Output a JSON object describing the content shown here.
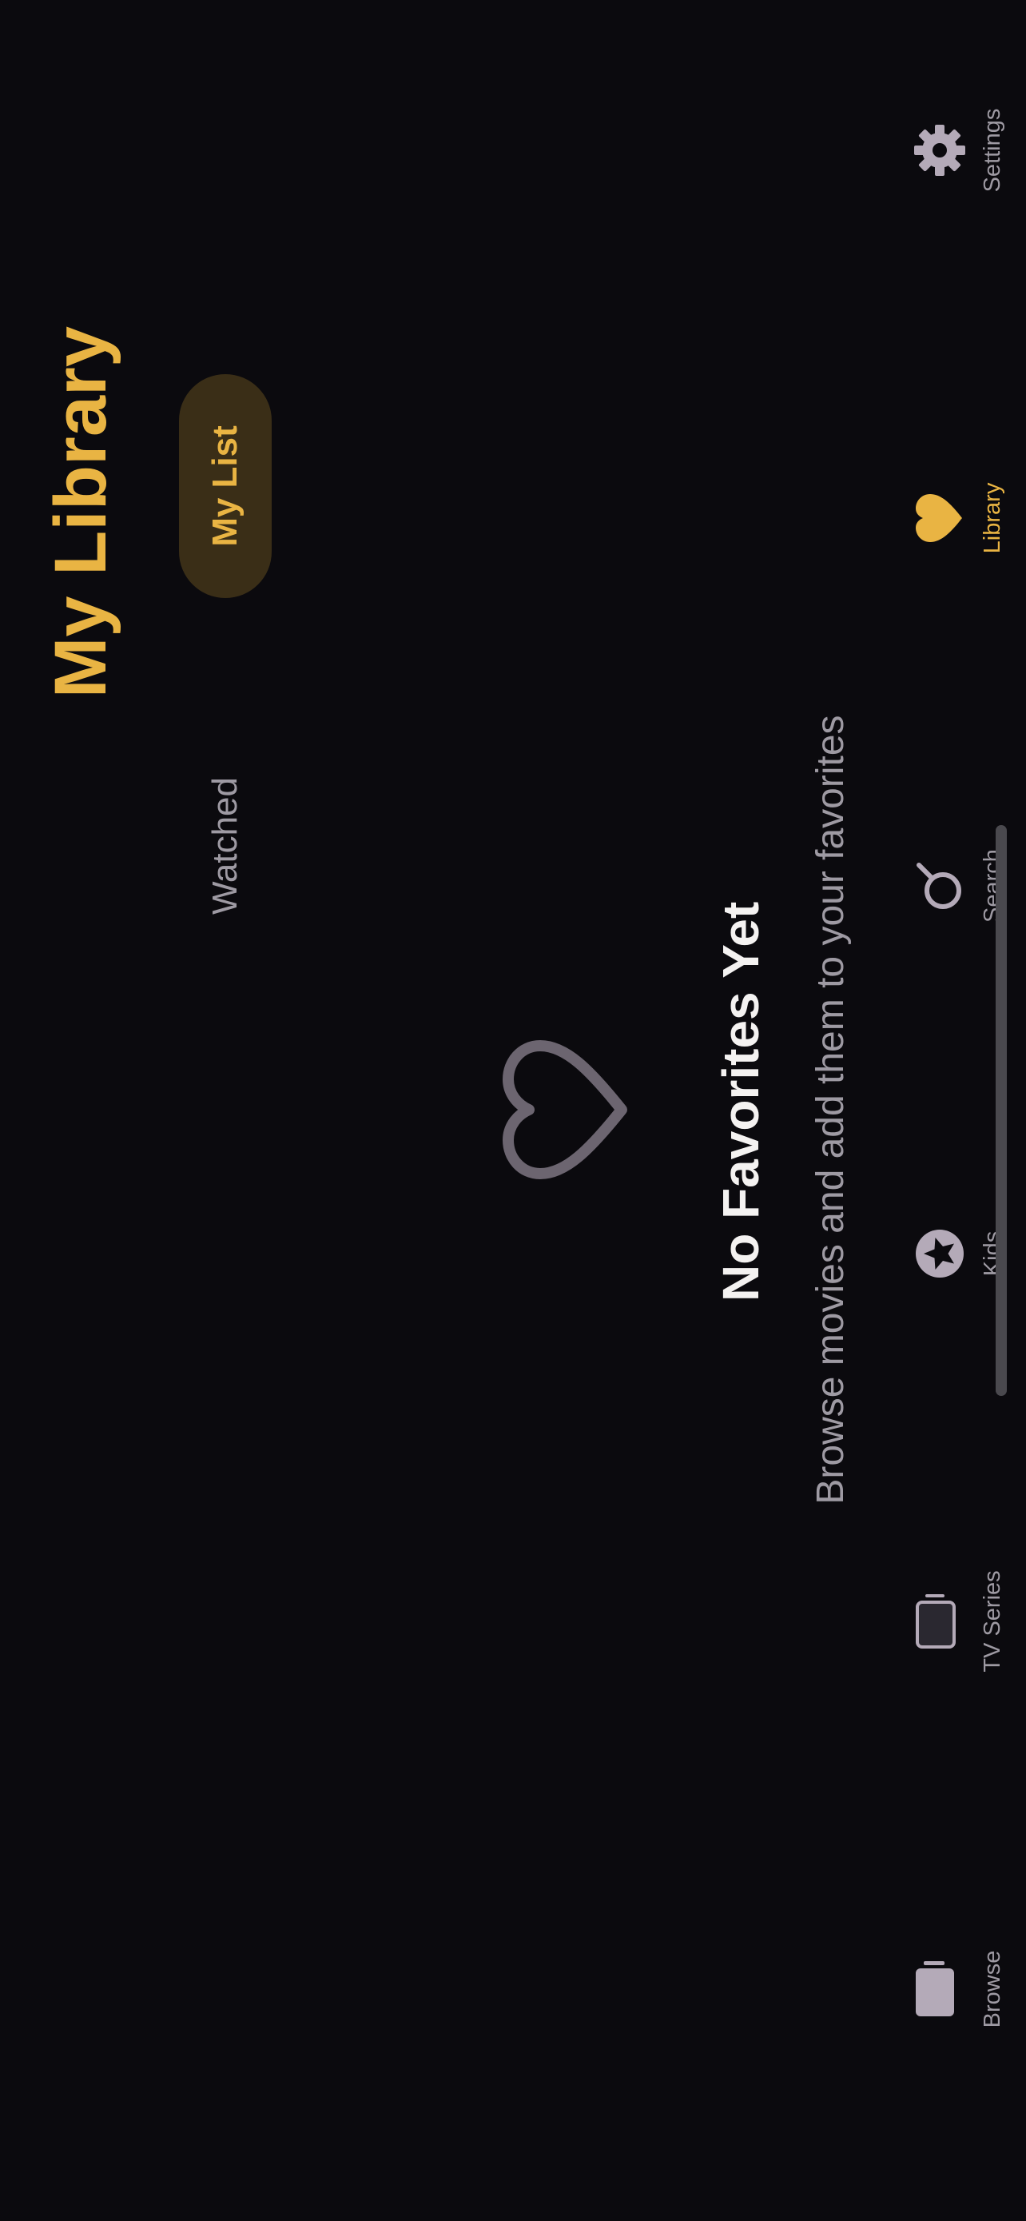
{
  "header": {
    "title": "My Library"
  },
  "segmented_control": {
    "tabs": [
      {
        "label": "My List",
        "selected": true
      },
      {
        "label": "Watched",
        "selected": false
      }
    ]
  },
  "empty_state": {
    "icon": "heart-outline-icon",
    "title": "No Favorites Yet",
    "subtitle": "Browse movies and add them to your favorites"
  },
  "tab_bar": {
    "items": [
      {
        "label": "Browse",
        "icon": "tv-filled-icon",
        "active": false
      },
      {
        "label": "TV Series",
        "icon": "tv-outline-icon",
        "active": false
      },
      {
        "label": "Kids",
        "icon": "star-circle-icon",
        "active": false
      },
      {
        "label": "Search",
        "icon": "magnifier-icon",
        "active": false
      },
      {
        "label": "Library",
        "icon": "heart-filled-icon",
        "active": true
      },
      {
        "label": "Settings",
        "icon": "gear-icon",
        "active": false
      }
    ]
  },
  "colors": {
    "background": "#0b0a0e",
    "accent": "#e9b443",
    "selected_pill": "#3a2e17",
    "secondary_text": "#9e9aa3",
    "primary_text": "#f4f2f1",
    "icon_muted": "#b4aab8",
    "heart_outline": "#6c6570"
  }
}
